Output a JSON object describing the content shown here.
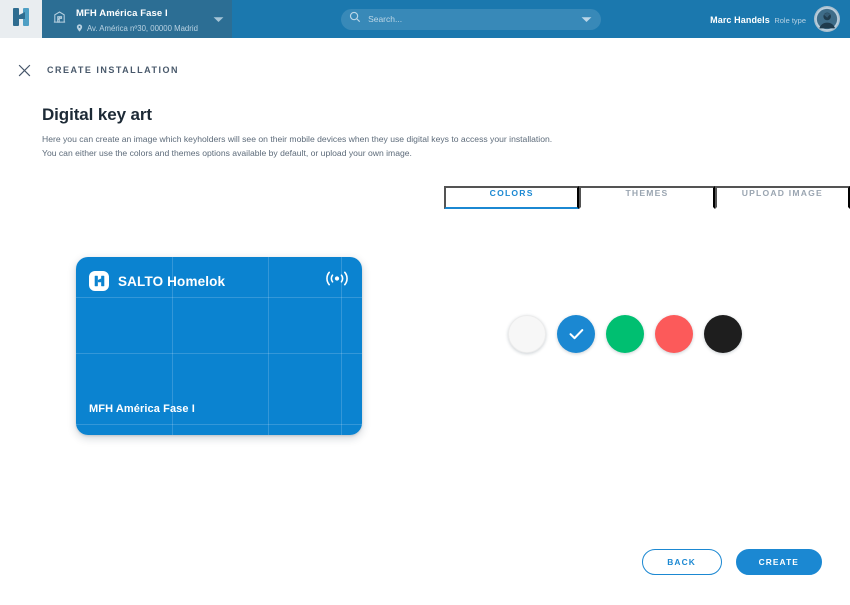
{
  "topbar": {
    "logo_icon": "homelok-h-logo-icon",
    "installation": {
      "icon": "building-icon",
      "name": "MFH América Fase I",
      "address_icon": "location-pin-icon",
      "address": "Av. América nº30, 00000 Madrid",
      "dropdown_icon": "chevron-down-icon"
    },
    "search": {
      "icon": "search-icon",
      "value": "",
      "placeholder": "Search...",
      "filter_icon": "chevron-down-icon"
    },
    "user": {
      "name": "Marc Handels",
      "role": "Role type",
      "avatar_icon": "user-avatar"
    }
  },
  "page_header": {
    "close_icon": "close-icon",
    "breadcrumb": "CREATE INSTALLATION"
  },
  "main": {
    "title": "Digital key art",
    "description_line_1": "Here you can create an image which keyholders will see on their mobile devices when they use digital keys to access your installation.",
    "description_line_2": "You can either use the colors and themes options available by default, or upload your own image.",
    "tabs": [
      {
        "label": "COLORS",
        "active": true
      },
      {
        "label": "THEMES",
        "active": false
      },
      {
        "label": "UPLOAD IMAGE",
        "active": false
      }
    ],
    "preview": {
      "brand_badge_icon": "salto-h-logo-icon",
      "brand_name": "SALTO Homelok",
      "nfc_icon": "contactless-nfc-icon",
      "installation_name": "MFH América Fase I",
      "background_color": "#0b83d0",
      "grid_line_color": "rgba(255,255,255,0.17)"
    },
    "swatches": [
      {
        "name": "white",
        "color": "#f7f7f7",
        "selected": false,
        "light": true
      },
      {
        "name": "blue",
        "color": "#1b88d2",
        "selected": true,
        "light": false
      },
      {
        "name": "green",
        "color": "#00bf71",
        "selected": false,
        "light": false
      },
      {
        "name": "red",
        "color": "#fc5a5a",
        "selected": false,
        "light": false
      },
      {
        "name": "black",
        "color": "#1e1e1e",
        "selected": false,
        "light": false
      }
    ],
    "selected_check_icon": "check-icon"
  },
  "footer": {
    "back_label": "BACK",
    "create_label": "CREATE"
  },
  "colors": {
    "header_blue": "#1b78ae",
    "header_blue_dark": "#2c6e94",
    "accent_blue": "#1b88d2",
    "card_blue": "#0b83d0",
    "text_dark": "#1d2a36",
    "text_muted": "#5d6b7a"
  }
}
